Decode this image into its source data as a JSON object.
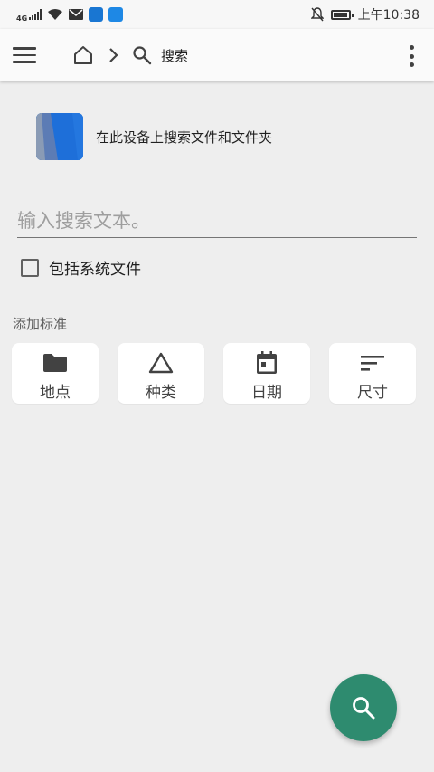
{
  "status_bar": {
    "network": "4G",
    "time": "上午10:38"
  },
  "app_bar": {
    "breadcrumb_title": "搜索"
  },
  "device_row": {
    "text": "在此设备上搜索文件和文件夹"
  },
  "search": {
    "placeholder": "输入搜索文本。",
    "value": ""
  },
  "include_system": {
    "label": "包括系统文件",
    "checked": false
  },
  "criteria": {
    "heading": "添加标准",
    "items": [
      {
        "label": "地点",
        "icon": "folder-icon"
      },
      {
        "label": "种类",
        "icon": "triangle-icon"
      },
      {
        "label": "日期",
        "icon": "calendar-icon"
      },
      {
        "label": "尺寸",
        "icon": "sort-icon"
      }
    ]
  },
  "colors": {
    "accent": "#2e8b6f",
    "device_icon": "#1565c0",
    "background": "#eeeeee"
  }
}
